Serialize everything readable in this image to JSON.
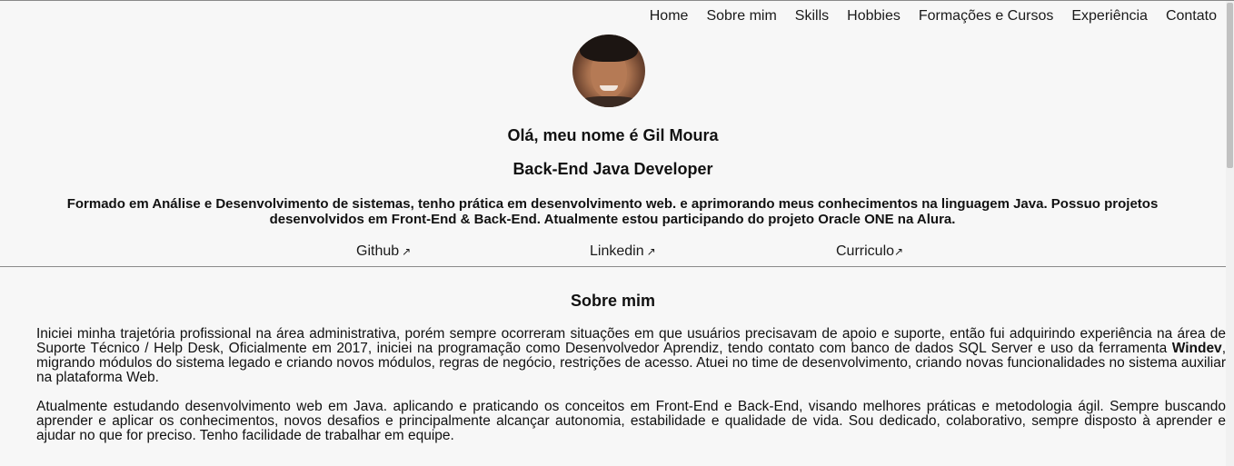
{
  "nav": {
    "items": [
      "Home",
      "Sobre mim",
      "Skills",
      "Hobbies",
      "Formações e Cursos",
      "Experiência",
      "Contato"
    ]
  },
  "hero": {
    "greeting": "Olá, meu nome é Gil Moura",
    "role": "Back-End Java Developer",
    "bio": "Formado em Análise e Desenvolvimento de sistemas, tenho prática em desenvolvimento web. e aprimorando meus conhecimentos na linguagem Java. Possuo projetos desenvolvidos em Front-End & Back-End. Atualmente estou participando do projeto Oracle ONE na Alura."
  },
  "links": {
    "github": "Github",
    "linkedin": "Linkedin",
    "curriculo": "Curriculo",
    "arrow": "↗"
  },
  "about": {
    "title": "Sobre mim",
    "p1_before": "Iniciei minha trajetória profissional na área administrativa, porém sempre ocorreram situações em que usuários precisavam de apoio e suporte, então fui adquirindo experiência na área de Suporte Técnico / Help Desk, Oficialmente em 2017, iniciei na programação como Desenvolvedor Aprendiz, tendo contato com banco de dados SQL Server e uso da ferramenta ",
    "p1_bold": "Windev",
    "p1_after": ", migrando módulos do sistema legado e criando novos módulos, regras de negócio, restrições de acesso. Atuei no time de desenvolvimento, criando novas funcionalidades no sistema auxiliar na plataforma Web.",
    "p2": "Atualmente estudando desenvolvimento web em Java. aplicando e praticando os conceitos em Front-End e Back-End, visando melhores práticas e metodologia ágil. Sempre buscando aprender e aplicar os conhecimentos, novos desafios e principalmente alcançar autonomia, estabilidade e qualidade de vida. Sou dedicado, colaborativo, sempre disposto à aprender e ajudar no que for preciso. Tenho facilidade de trabalhar em equipe."
  }
}
